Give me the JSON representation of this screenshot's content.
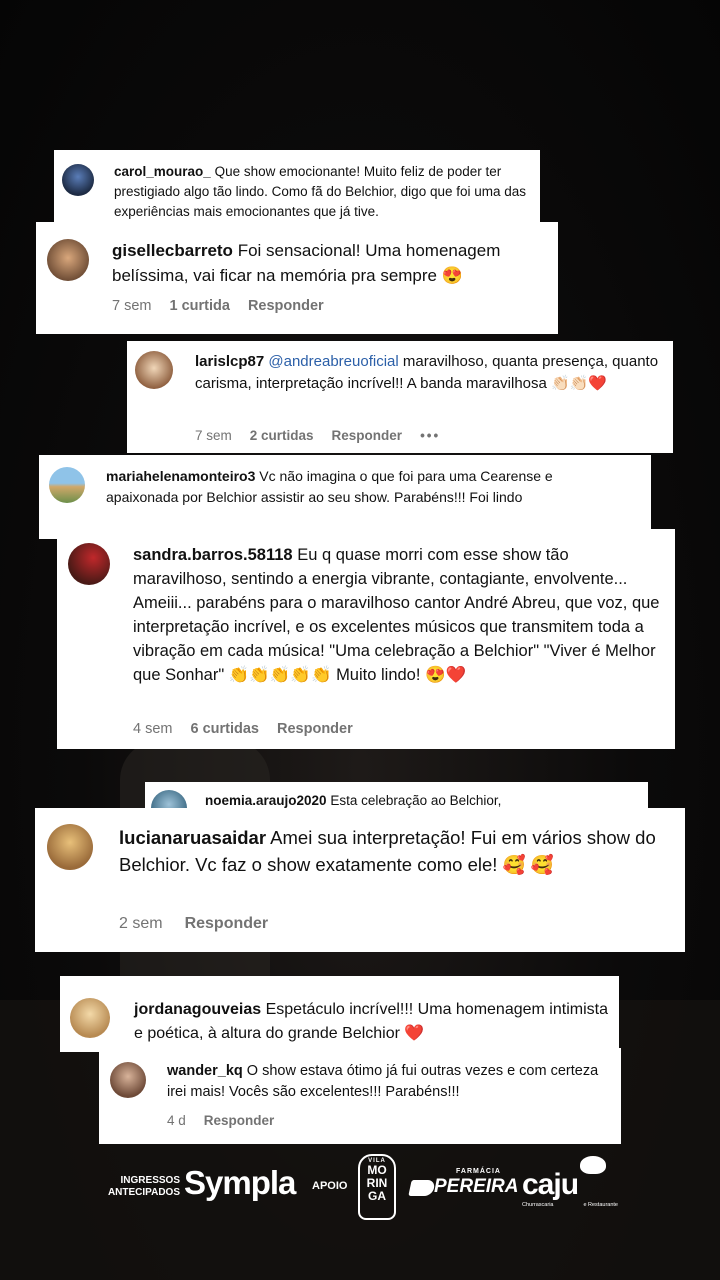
{
  "comments": [
    {
      "handle": "carol_mourao_",
      "text": "Que show emocionante! Muito feliz de poder ter prestigiado algo tão lindo. Como fã do Belchior, digo que foi uma das experiências mais emocionantes que já tive."
    },
    {
      "handle": "gisellecbarreto",
      "text": "Foi sensacional! Uma homenagem belíssima, vai ficar na memória pra sempre 😍",
      "time": "7 sem",
      "likes": "1 curtida",
      "reply": "Responder"
    },
    {
      "handle": "larislcp87",
      "mention": "@andreabreuoficial",
      "text": "maravilhoso, quanta presença, quanto carisma, interpretação incrível!! A banda maravilhosa 👏🏻👏🏻❤️",
      "time": "7 sem",
      "likes": "2 curtidas",
      "reply": "Responder",
      "more": "•••"
    },
    {
      "handle": "mariahelenamonteiro3",
      "text": "Vc não imagina o que foi para uma Cearense e apaixonada por Belchior assistir ao seu show. Parabéns!!! Foi lindo"
    },
    {
      "handle": "sandra.barros.58118",
      "text": "Eu q quase morri com esse show tão maravilhoso, sentindo a energia vibrante, contagiante, envolvente... Ameiii... parabéns para o maravilhoso cantor André Abreu, que voz, que interpretação incrível, e os excelentes músicos que transmitem toda a vibração em cada música! \"Uma celebração a Belchior\" \"Viver é Melhor que Sonhar\" 👏👏👏👏👏 Muito lindo! 😍❤️",
      "time": "4 sem",
      "likes": "6 curtidas",
      "reply": "Responder"
    },
    {
      "handle": "noemia.araujo2020",
      "text": "Esta celebração ao Belchior,"
    },
    {
      "handle": "lucianaruasaidar",
      "text": "Amei sua interpretação! Fui em vários show do Belchior. Vc faz o show exatamente como ele! 🥰 🥰",
      "time": "2 sem",
      "reply": "Responder"
    },
    {
      "handle": "jordanagouveias",
      "text": "Espetáculo incrível!!! Uma homenagem intimista e poética, à altura do grande Belchior ❤️"
    },
    {
      "handle": "wander_kq",
      "text": "O show estava ótimo já fui outras vezes e com certeza irei mais! Vocês são excelentes!!! Parabéns!!!",
      "time": "4 d",
      "reply": "Responder"
    }
  ],
  "footer": {
    "sympla_small_1": "INGRESSOS",
    "sympla_small_2": "ANTECIPADOS",
    "sympla": "Sympla",
    "apoio": "APOIO",
    "vila": "VILA",
    "moringa_1": "MO",
    "moringa_2": "RIN",
    "moringa_3": "GA",
    "farmacia_small": "FARMÁCIA",
    "pereira": "PEREIRA",
    "caju": "caju",
    "caju_small_1": "Churrascaria",
    "caju_small_2": "e Restaurante"
  },
  "colors": {
    "mention": "#2b5fa8",
    "meta": "#737373",
    "heart": "#e0245e",
    "card": "#ffffff"
  }
}
